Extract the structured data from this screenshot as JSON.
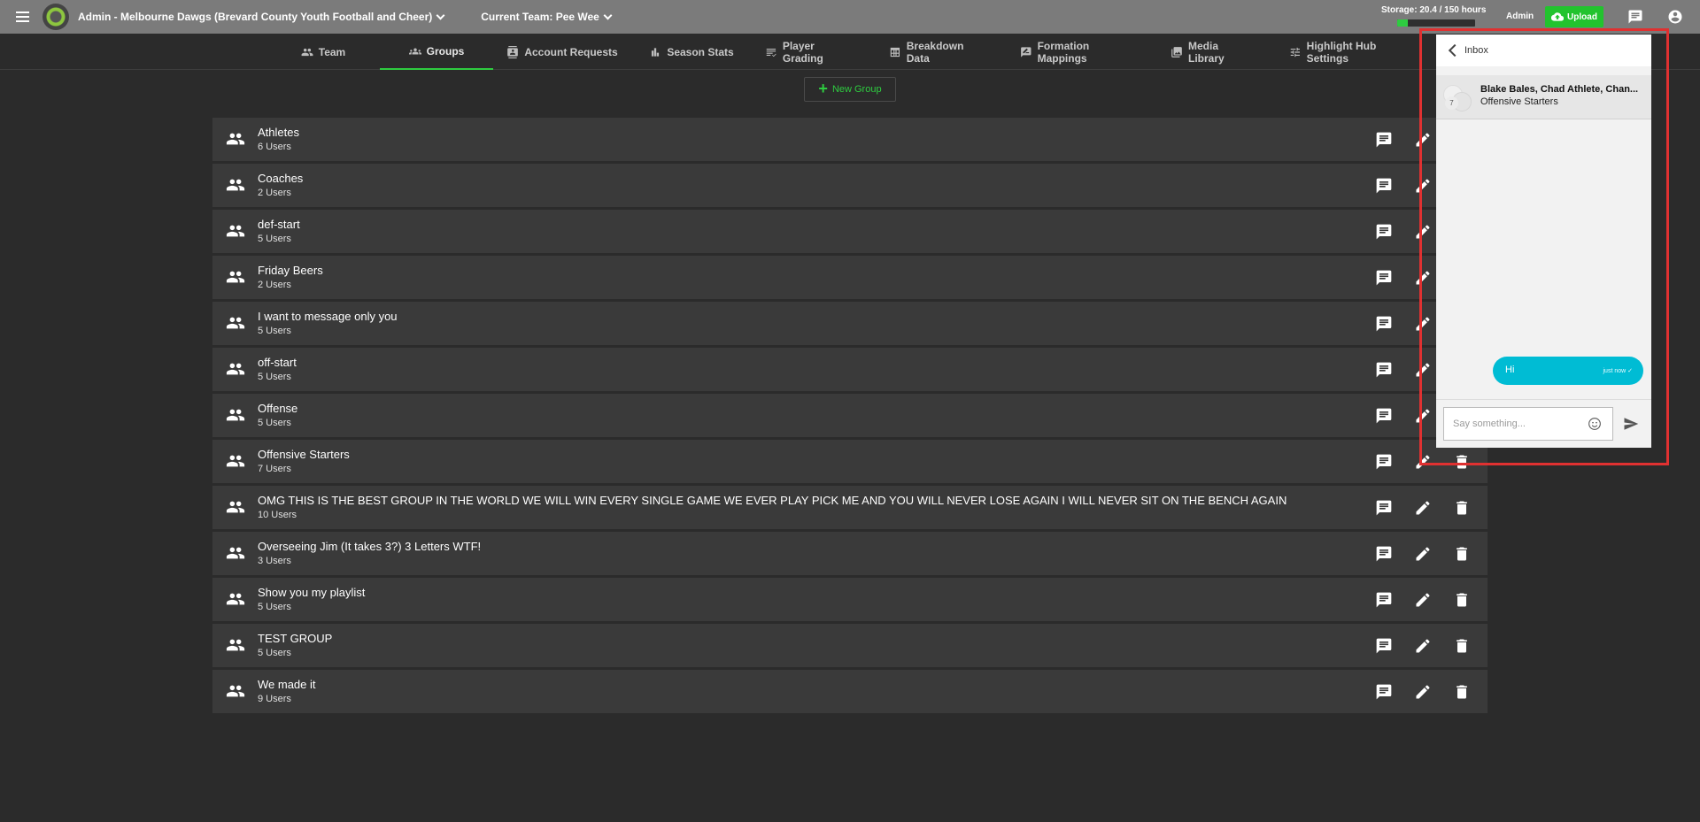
{
  "topbar": {
    "org_label": "Admin - Melbourne Dawgs (Brevard County Youth Football and Cheer)",
    "team_label": "Current Team: Pee Wee",
    "storage_label": "Storage: 20.4 / 150 hours",
    "storage_used_fraction": 0.136,
    "admin_label": "Admin",
    "upload_label": "Upload",
    "icons": [
      "menu-icon",
      "logo",
      "chevron-down-icon",
      "cloud-upload-icon",
      "chat-icon",
      "account-circle-icon"
    ],
    "accent_color": "#22c32e"
  },
  "nav": {
    "tabs": [
      {
        "label": "Team",
        "icon": "people-icon"
      },
      {
        "label": "Groups",
        "icon": "groups-icon",
        "active": true
      },
      {
        "label": "Account Requests",
        "icon": "contact-card-icon"
      },
      {
        "label": "Season Stats",
        "icon": "bar-chart-icon"
      },
      {
        "label": "Player Grading",
        "icon": "list-icon"
      },
      {
        "label": "Breakdown Data",
        "icon": "table-icon"
      },
      {
        "label": "Formation Mappings",
        "icon": "draw-icon"
      },
      {
        "label": "Media Library",
        "icon": "photo-library-icon"
      },
      {
        "label": "Highlight Hub Settings",
        "icon": "tune-icon"
      }
    ]
  },
  "new_group_label": "New Group",
  "groups": [
    {
      "name": "Athletes",
      "count": "6 Users"
    },
    {
      "name": "Coaches",
      "count": "2 Users"
    },
    {
      "name": "def-start",
      "count": "5 Users"
    },
    {
      "name": "Friday Beers",
      "count": "2 Users"
    },
    {
      "name": "I want to message only you",
      "count": "5 Users"
    },
    {
      "name": "off-start",
      "count": "5 Users"
    },
    {
      "name": "Offense",
      "count": "5 Users"
    },
    {
      "name": "Offensive Starters",
      "count": "7 Users"
    },
    {
      "name": "OMG THIS IS THE BEST GROUP IN THE WORLD WE WILL WIN EVERY SINGLE GAME WE EVER PLAY PICK ME AND YOU WILL NEVER LOSE AGAIN I WILL NEVER SIT ON THE BENCH AGAIN",
      "count": "10 Users"
    },
    {
      "name": "Overseeing Jim (It takes 3?) 3 Letters WTF!",
      "count": "3 Users"
    },
    {
      "name": "Show you my playlist",
      "count": "5 Users"
    },
    {
      "name": "TEST GROUP",
      "count": "5 Users"
    },
    {
      "name": "We made it",
      "count": "9 Users"
    }
  ],
  "chat": {
    "header_label": "Inbox",
    "conversation": {
      "names": "Blake Bales, Chad Athlete, Chan...",
      "group": "Offensive Starters",
      "member_count": "7"
    },
    "message": {
      "text": "Hi",
      "time": "just now ✓"
    },
    "input_placeholder": "Say something...",
    "bubble_color": "#00bcd4"
  },
  "highlight_color": "#e03131"
}
